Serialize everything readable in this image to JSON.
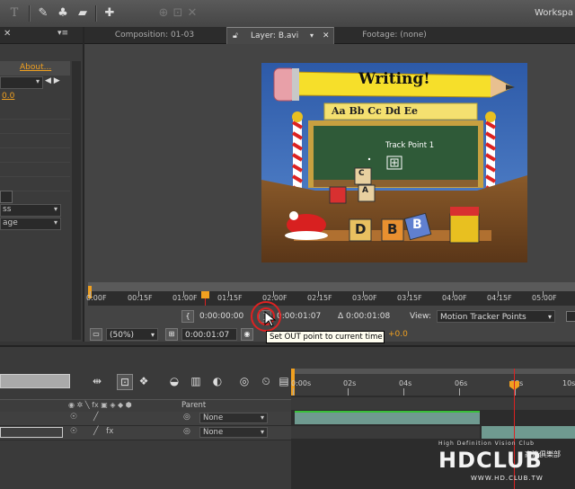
{
  "toolbar": {
    "workspace_label": "Workspa",
    "icons": [
      "text-tool-icon",
      "pen-tool-icon",
      "clone-stamp-icon",
      "eraser-icon",
      "puppet-pin-icon",
      "axis-icon",
      "snapping-icon"
    ]
  },
  "left_panel": {
    "about_link": "About...",
    "value": "0.0",
    "dropdown1": "ss",
    "dropdown2": "age"
  },
  "viewer": {
    "tabs": [
      {
        "label": "Composition: 01-03",
        "active": false
      },
      {
        "label": "Layer: B.avi",
        "active": true
      },
      {
        "label": "Footage: (none)",
        "active": false
      }
    ],
    "frame": {
      "title": "Writing!",
      "alphabet": "Aa Bb Cc Dd Ee",
      "track_point_label": "Track Point 1",
      "blocks": [
        "C",
        "A",
        "D",
        "B",
        "B"
      ]
    },
    "ruler_labels": [
      "0:00F",
      "00:15F",
      "01:00F",
      "01:15F",
      "02:00F",
      "02:15F",
      "03:00F",
      "03:15F",
      "04:00F",
      "04:15F",
      "05:00F"
    ],
    "in_point": "0:00:00:00",
    "out_point": "0:00:01:07",
    "duration": "Δ 0:00:01:08",
    "view_label": "View:",
    "view_value": "Motion Tracker Points",
    "zoom": "(50%)",
    "current_time": "0:00:01:07",
    "offset": "+0.0",
    "tooltip": "Set OUT point to current time"
  },
  "timeline": {
    "header_parent": "Parent",
    "ruler_labels": [
      "0:00s",
      "02s",
      "04s",
      "06s",
      "08s",
      "10s"
    ],
    "layers": [
      {
        "parent": "None"
      },
      {
        "parent": "None"
      }
    ]
  },
  "logo": {
    "tagline": "High Definition Vision Club",
    "brand": "HDCLUB",
    "chinese": "高清俱樂部",
    "url": "WWW.HD.CLUB.TW"
  },
  "colors": {
    "accent_orange": "#f0a020",
    "playhead_red": "#d22222",
    "layer_bar_teal": "#6f9a90"
  }
}
